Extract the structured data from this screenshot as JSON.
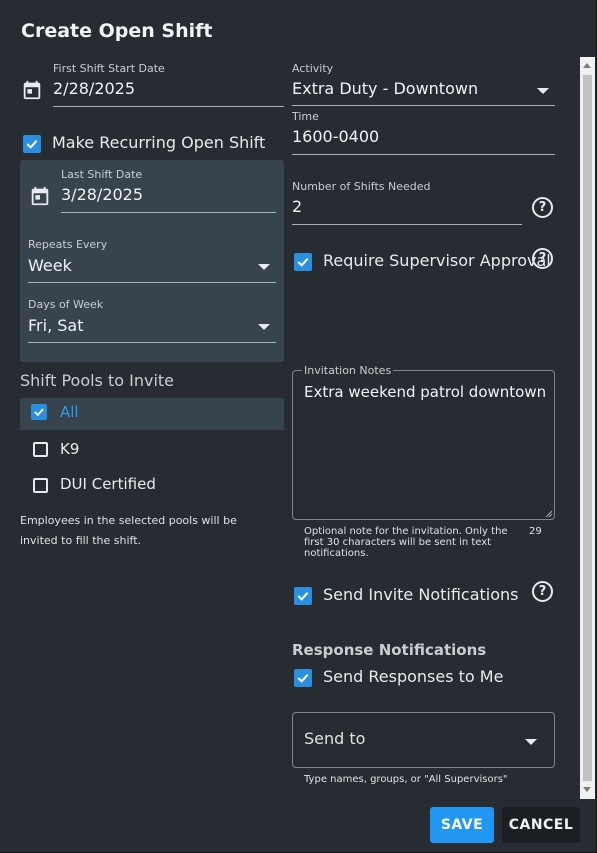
{
  "dialog": {
    "title": "Create Open Shift"
  },
  "first_shift": {
    "label": "First Shift Start Date",
    "value": "2/28/2025"
  },
  "recurring": {
    "label": "Make Recurring Open Shift",
    "checked": true,
    "last_shift": {
      "label": "Last Shift Date",
      "value": "3/28/2025"
    },
    "repeats": {
      "label": "Repeats Every",
      "value": "Week"
    },
    "days": {
      "label": "Days of Week",
      "value": "Fri, Sat"
    }
  },
  "pools": {
    "title": "Shift Pools to Invite",
    "items": [
      {
        "label": "All",
        "checked": true
      },
      {
        "label": "K9",
        "checked": false
      },
      {
        "label": "DUI Certified",
        "checked": false
      }
    ],
    "help_text": "Employees in the selected pools will be invited to fill the shift."
  },
  "activity": {
    "label": "Activity",
    "value": "Extra Duty - Downtown"
  },
  "time": {
    "label": "Time",
    "value": "1600-0400"
  },
  "shifts_needed": {
    "label": "Number of Shifts Needed",
    "value": "2"
  },
  "supervisor_approval": {
    "label": "Require Supervisor Approval",
    "checked": true
  },
  "notes": {
    "label": "Invitation Notes",
    "value": "Extra weekend patrol downtown",
    "hint": "Optional note for the invitation. Only the first 30 characters will be sent in text notifications.",
    "count": "29"
  },
  "send_invites": {
    "label": "Send Invite Notifications",
    "checked": true
  },
  "response": {
    "title": "Response Notifications",
    "send_to_me": {
      "label": "Send Responses to Me",
      "checked": true
    },
    "send_to": {
      "placeholder": "Send to",
      "hint": "Type names, groups, or \"All Supervisors\""
    }
  },
  "buttons": {
    "save": "SAVE",
    "cancel": "CANCEL"
  },
  "colors": {
    "accent": "#2196f3",
    "checkbox": "#2b8fe0",
    "background": "#262c32",
    "panel": "#37444e"
  },
  "icons": [
    "calendar-icon",
    "check-icon",
    "caret-down-icon",
    "help-icon"
  ]
}
